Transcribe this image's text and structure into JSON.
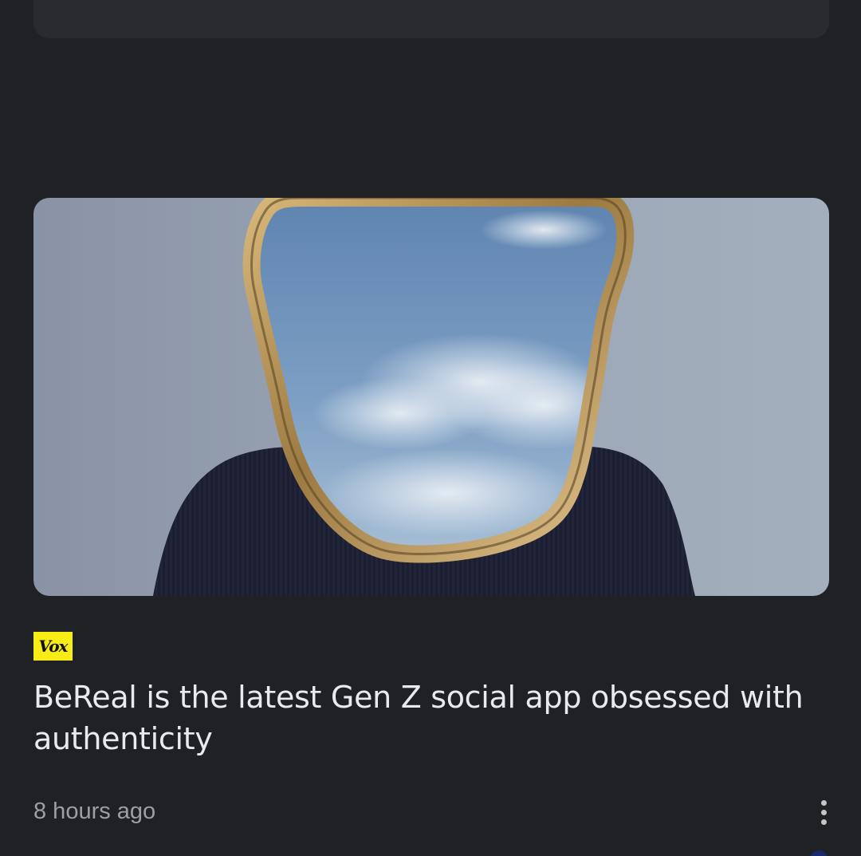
{
  "article": {
    "image_alt": "Empty ornate golden mirror frame held in front of a person's head showing blue sky with clouds",
    "source": {
      "name": "Vox",
      "logo_text": "Vox",
      "logo_color": "#f8ec16"
    },
    "headline": "BeReal is the latest Gen Z social app obsessed with authenticity",
    "timestamp": "8 hours ago",
    "menu_icon": "more-vert-icon"
  },
  "colors": {
    "background": "#202124",
    "card": "#2a2b2e",
    "headline_text": "#e8eaed",
    "secondary_text": "#9aa0a6"
  }
}
